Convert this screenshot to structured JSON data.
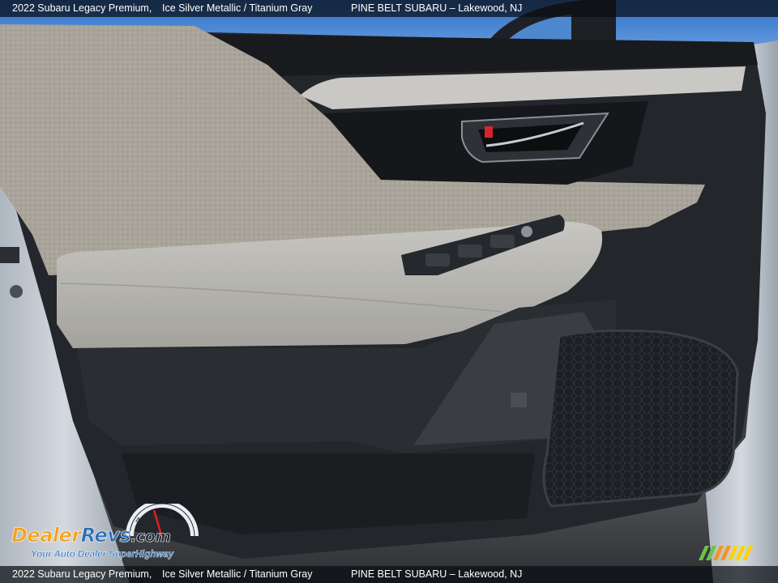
{
  "caption": {
    "vehicle": "2022 Subaru Legacy Premium,",
    "color": "Ice Silver Metallic / Titanium Gray",
    "dealer": "PINE BELT SUBARU – Lakewood, NJ"
  },
  "watermark": {
    "logo_text": "DealerRevs.com",
    "tagline": "Your Auto Dealer SuperHighway"
  },
  "colors": {
    "sky": "#3f7fd0",
    "upholstery": "#a9a49a",
    "armrest": "#b9b8b3",
    "door_trim": "#23262b",
    "car_body_silver": "#c2c9d2",
    "caption_bar": "#0a0e14",
    "logo_orange": "#f5a21b",
    "logo_blue": "#2f6fb6",
    "stripe_green": "#6cc24a",
    "stripe_orange": "#f7941d",
    "stripe_yellow": "#ffd200"
  },
  "icons": [
    "door-handle-icon",
    "window-switch-icon",
    "speaker-grille-icon",
    "speedometer-logo-icon"
  ]
}
